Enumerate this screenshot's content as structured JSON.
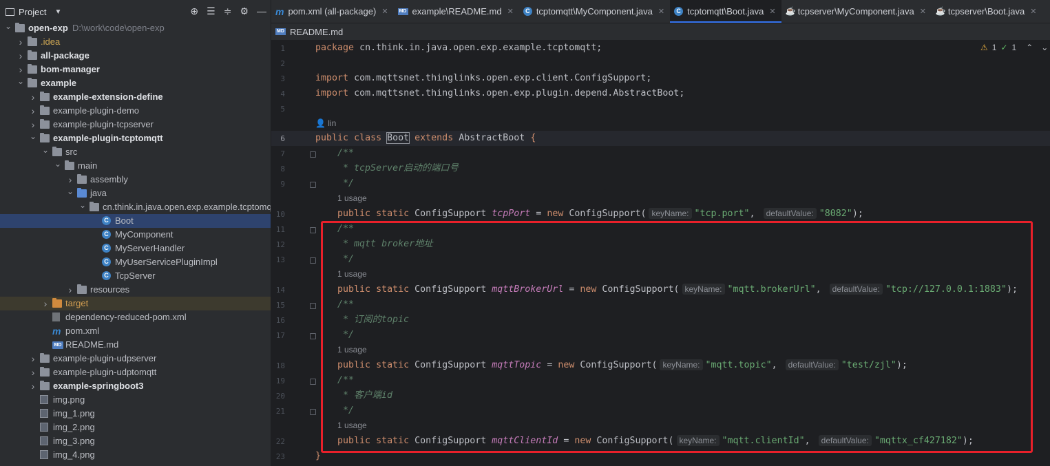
{
  "project": {
    "title": "Project",
    "root": {
      "name": "open-exp",
      "path": "D:\\work\\code\\open-exp"
    },
    "tree": [
      {
        "label": "open-exp",
        "extra": "D:\\work\\code\\open-exp",
        "depth": 0,
        "kind": "folder",
        "open": true,
        "bold": true
      },
      {
        "label": ".idea",
        "depth": 1,
        "kind": "folder",
        "open": false,
        "color": "yellow"
      },
      {
        "label": "all-package",
        "depth": 1,
        "kind": "folder",
        "open": false,
        "bold": true
      },
      {
        "label": "bom-manager",
        "depth": 1,
        "kind": "folder",
        "open": false,
        "bold": true
      },
      {
        "label": "example",
        "depth": 1,
        "kind": "folder",
        "open": true,
        "bold": true
      },
      {
        "label": "example-extension-define",
        "depth": 2,
        "kind": "folder",
        "open": false,
        "bold": true
      },
      {
        "label": "example-plugin-demo",
        "depth": 2,
        "kind": "folder",
        "open": false
      },
      {
        "label": "example-plugin-tcpserver",
        "depth": 2,
        "kind": "folder",
        "open": false
      },
      {
        "label": "example-plugin-tcptomqtt",
        "depth": 2,
        "kind": "folder",
        "open": true,
        "bold": true
      },
      {
        "label": "src",
        "depth": 3,
        "kind": "folder",
        "open": true
      },
      {
        "label": "main",
        "depth": 4,
        "kind": "folder",
        "open": true
      },
      {
        "label": "assembly",
        "depth": 5,
        "kind": "folder",
        "open": false
      },
      {
        "label": "java",
        "depth": 5,
        "kind": "folder-blue",
        "open": true
      },
      {
        "label": "cn.think.in.java.open.exp.example.tcptomqtt",
        "depth": 6,
        "kind": "folder",
        "open": true
      },
      {
        "label": "Boot",
        "depth": 7,
        "kind": "class",
        "selected": true
      },
      {
        "label": "MyComponent",
        "depth": 7,
        "kind": "class"
      },
      {
        "label": "MyServerHandler",
        "depth": 7,
        "kind": "class"
      },
      {
        "label": "MyUserServicePluginImpl",
        "depth": 7,
        "kind": "class"
      },
      {
        "label": "TcpServer",
        "depth": 7,
        "kind": "class"
      },
      {
        "label": "resources",
        "depth": 5,
        "kind": "folder",
        "open": false
      },
      {
        "label": "target",
        "depth": 3,
        "kind": "folder-orange",
        "open": false,
        "color": "orange",
        "target": true
      },
      {
        "label": "dependency-reduced-pom.xml",
        "depth": 3,
        "kind": "file"
      },
      {
        "label": "pom.xml",
        "depth": 3,
        "kind": "maven"
      },
      {
        "label": "README.md",
        "depth": 3,
        "kind": "md"
      },
      {
        "label": "example-plugin-udpserver",
        "depth": 2,
        "kind": "folder",
        "open": false
      },
      {
        "label": "example-plugin-udptomqtt",
        "depth": 2,
        "kind": "folder",
        "open": false
      },
      {
        "label": "example-springboot3",
        "depth": 2,
        "kind": "folder",
        "open": false,
        "bold": true
      },
      {
        "label": "img.png",
        "depth": 2,
        "kind": "image"
      },
      {
        "label": "img_1.png",
        "depth": 2,
        "kind": "image"
      },
      {
        "label": "img_2.png",
        "depth": 2,
        "kind": "image"
      },
      {
        "label": "img_3.png",
        "depth": 2,
        "kind": "image"
      },
      {
        "label": "img_4.png",
        "depth": 2,
        "kind": "image"
      }
    ]
  },
  "tabs": [
    {
      "label": "pom.xml (all-package)",
      "icon": "maven-icon",
      "active": false
    },
    {
      "label": "example\\README.md",
      "icon": "markdown-icon",
      "active": false
    },
    {
      "label": "tcptomqtt\\MyComponent.java",
      "icon": "class-icon",
      "active": false
    },
    {
      "label": "tcptomqtt\\Boot.java",
      "icon": "class-icon",
      "active": true
    },
    {
      "label": "tcpserver\\MyComponent.java",
      "icon": "java-icon",
      "active": false
    },
    {
      "label": "tcpserver\\Boot.java",
      "icon": "java-icon",
      "active": false
    }
  ],
  "tabs_row2": [
    {
      "label": "README.md",
      "icon": "markdown-icon"
    }
  ],
  "inspections": {
    "warnings": "1",
    "weak_warnings": "1"
  },
  "editor": {
    "author": "lin",
    "usage": "1 usage",
    "package_kw": "package",
    "package_name": "cn.think.in.java.open.exp.example.tcptomqtt;",
    "import_kw": "import",
    "import1": "com.mqttsnet.thinglinks.open.exp.client.ConfigSupport;",
    "import2": "com.mqttsnet.thinglinks.open.exp.plugin.depend.AbstractBoot;",
    "class_decl": {
      "public": "public",
      "class": "class",
      "name": "Boot",
      "extends": "extends",
      "parent": "AbstractBoot",
      "brace": "{"
    },
    "comment_open": "/**",
    "comment_close": "*/",
    "fields": [
      {
        "comment": "* tcpServer启动的端口号",
        "name": "tcpPort",
        "key": "\"tcp.port\"",
        "default": "\"8082\""
      },
      {
        "comment": "* mqtt broker地址",
        "name": "mqttBrokerUrl",
        "key": "\"mqtt.brokerUrl\"",
        "default": "\"tcp://127.0.0.1:1883\""
      },
      {
        "comment": "* 订阅的topic",
        "name": "mqttTopic",
        "key": "\"mqtt.topic\"",
        "default": "\"test/zjl\""
      },
      {
        "comment": "* 客户端id",
        "name": "mqttClientId",
        "key": "\"mqtt.clientId\"",
        "default": "\"mqttx_cf427182\""
      }
    ],
    "kw_public": "public",
    "kw_static": "static",
    "type": "ConfigSupport",
    "eq": "=",
    "kw_new": "new",
    "ctor": "ConfigSupport(",
    "hint_key": "keyName:",
    "hint_default": "defaultValue:",
    "comma": ",",
    "close": ");",
    "end_brace": "}",
    "line_numbers": [
      "1",
      "2",
      "3",
      "4",
      "5",
      "6",
      "7",
      "8",
      "9",
      "10",
      "11",
      "12",
      "13",
      "14",
      "15",
      "16",
      "17",
      "18",
      "19",
      "20",
      "21",
      "22",
      "23"
    ]
  }
}
